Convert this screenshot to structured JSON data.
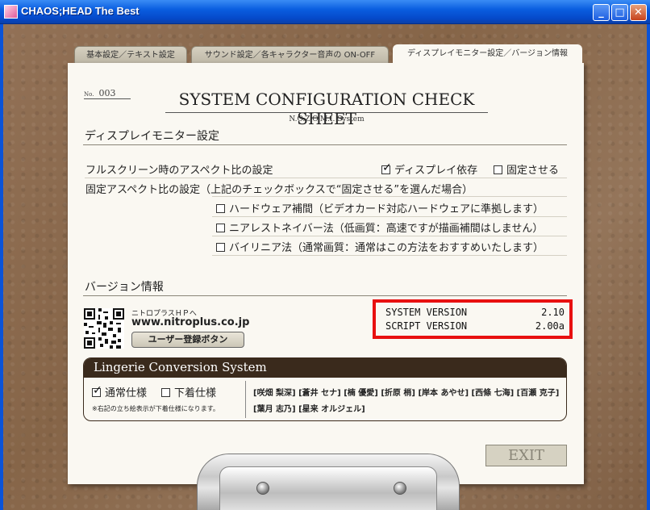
{
  "window": {
    "title": "CHAOS;HEAD The Best",
    "min_glyph": "_",
    "max_glyph": "□",
    "close_glyph": "✕"
  },
  "tabs": [
    {
      "label": "基本設定／テキスト設定",
      "active": false
    },
    {
      "label": "サウンド設定／各キャラクター音声の ON-OFF",
      "active": false
    },
    {
      "label": "ディスプレイモニター設定／バージョン情報",
      "active": true
    }
  ],
  "sheet": {
    "no_label": "No.",
    "number": "003",
    "title": "SYSTEM CONFIGURATION CHECK SHEET",
    "subtitle": "N.O.Z.O.M.I. System"
  },
  "display": {
    "section_title": "ディスプレイモニター設定",
    "aspect_label": "フルスクリーン時のアスペクト比の設定",
    "opt_display": {
      "label": "ディスプレイ依存",
      "checked": true
    },
    "opt_fixed": {
      "label": "固定させる",
      "checked": false
    },
    "fixed_label": "固定アスペクト比の設定（上記のチェックボックスで“固定させる”を選んだ場合）",
    "interp": [
      {
        "label": "ハードウェア補間（ビデオカード対応ハードウェアに準拠します）",
        "checked": false
      },
      {
        "label": "ニアレストネイバー法（低画質：高速ですが描画補間はしません）",
        "checked": false
      },
      {
        "label": "バイリニア法（通常画質：通常はこの方法をおすすめいたします）",
        "checked": false
      }
    ]
  },
  "version": {
    "section_title": "バージョン情報",
    "nitro_small": "ニトロプラスＨＰへ",
    "nitro_url": "www.nitroplus.co.jp",
    "register_button": "ユーザー登録ボタン",
    "system_label": "SYSTEM VERSION",
    "system_value": "2.10",
    "script_label": "SCRIPT VERSION",
    "script_value": "2.00a",
    "highlight_color": "#e81010"
  },
  "lingerie": {
    "title": "Lingerie Conversion System",
    "opt_normal": {
      "label": "通常仕様",
      "checked": true
    },
    "opt_under": {
      "label": "下着仕様",
      "checked": false
    },
    "note": "※右記の立ち絵表示が下着仕様になります。",
    "names": [
      "[咲畑 梨深]",
      "[蒼井 セナ]",
      "[楠 優愛]",
      "[折原 梢]",
      "[岸本 あやせ]",
      "[西條 七海]",
      "[百瀬 克子]",
      "[葉月 志乃]",
      "[星来 オルジェル]"
    ]
  },
  "exit_button": "EXIT"
}
